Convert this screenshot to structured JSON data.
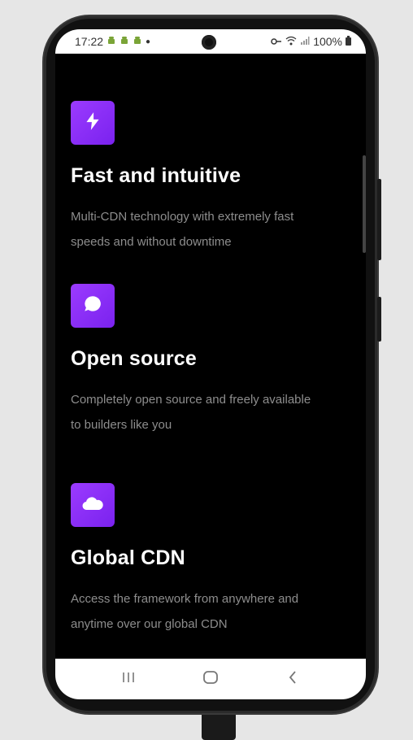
{
  "status_bar": {
    "time": "17:22",
    "battery": "100%",
    "icons_left": [
      "android-icon",
      "android-icon",
      "android-icon",
      "dot-icon"
    ],
    "icons_right": [
      "key-icon",
      "wifi-icon",
      "signal-icon",
      "battery-icon"
    ]
  },
  "features": [
    {
      "icon": "lightning-icon",
      "title": "Fast and intuitive",
      "description_line1": "Multi-CDN technology with extremely fast",
      "description_line2": "speeds and without downtime"
    },
    {
      "icon": "chat-bubble-icon",
      "title": "Open source",
      "description_line1": "Completely open source and freely available",
      "description_line2": "to builders like you"
    },
    {
      "icon": "cloud-icon",
      "title": "Global CDN",
      "description_line1": "Access the framework from anywhere and",
      "description_line2": "anytime over our global CDN"
    }
  ],
  "nav_bar": {
    "buttons": [
      "recent-apps-icon",
      "home-icon",
      "back-icon"
    ]
  },
  "colors": {
    "accent": "#8b2ff7",
    "background": "#000000",
    "title": "#ffffff",
    "description": "#8d8d8d"
  }
}
